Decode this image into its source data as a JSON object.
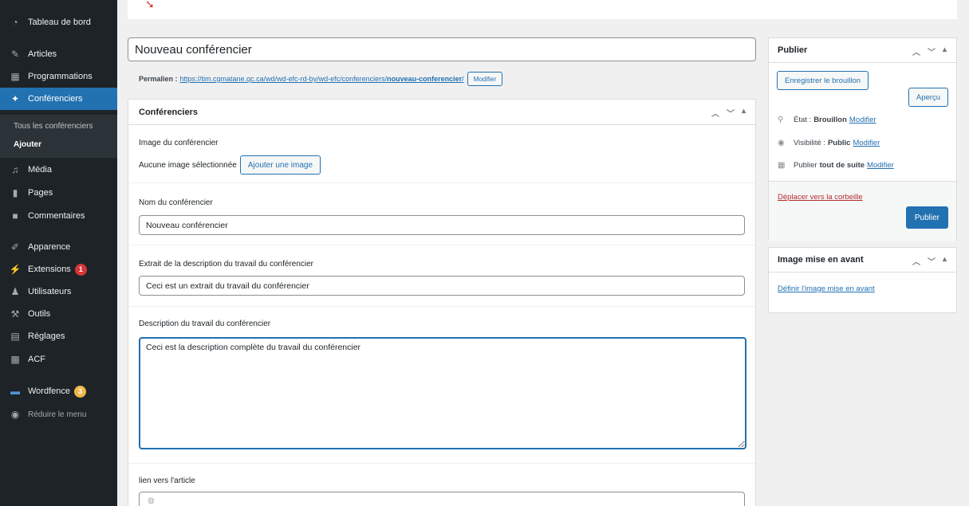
{
  "sidebar": {
    "items": [
      {
        "label": "Tableau de bord",
        "icon": "dashboard-icon"
      },
      {
        "label": "Articles",
        "icon": "pin-icon"
      },
      {
        "label": "Programmations",
        "icon": "calendar-icon"
      },
      {
        "label": "Conférenciers",
        "icon": "person-icon"
      },
      {
        "label": "Média",
        "icon": "media-icon"
      },
      {
        "label": "Pages",
        "icon": "page-icon"
      },
      {
        "label": "Commentaires",
        "icon": "comment-icon"
      },
      {
        "label": "Apparence",
        "icon": "brush-icon"
      },
      {
        "label": "Extensions",
        "icon": "plugin-icon",
        "badge": "1"
      },
      {
        "label": "Utilisateurs",
        "icon": "users-icon"
      },
      {
        "label": "Outils",
        "icon": "wrench-icon"
      },
      {
        "label": "Réglages",
        "icon": "settings-icon"
      },
      {
        "label": "ACF",
        "icon": "acf-icon"
      },
      {
        "label": "Wordfence",
        "icon": "shield-icon",
        "badge": "3"
      },
      {
        "label": "Réduire le menu",
        "icon": "collapse-icon"
      }
    ],
    "submenu": [
      {
        "label": "Tous les conférenciers"
      },
      {
        "label": "Ajouter"
      }
    ],
    "accent_color": "#2271b1"
  },
  "editor": {
    "title_value": "Nouveau conférencier",
    "permalink": {
      "label": "Permalien :",
      "url_base": "https://tim.cgmatane.qc.ca/wd/wd-efc-rd-by/wd-efc/conferenciers/",
      "url_slug": "nouveau-conferencier",
      "url_end": "/",
      "edit_label": "Modifier"
    }
  },
  "metabox": {
    "title": "Conférenciers",
    "image": {
      "label": "Image du conférencier",
      "none_text": "Aucune image sélectionnée",
      "add_button": "Ajouter une image"
    },
    "name": {
      "label": "Nom du conférencier",
      "value": "Nouveau conférencier"
    },
    "excerpt": {
      "label": "Extrait de la description du travail du conférencier",
      "value": "Ceci est un extrait du travail du conférencier"
    },
    "description": {
      "label": "Description du travail du conférencier",
      "value": "Ceci est la description complète du travail du conférencier"
    },
    "link": {
      "label": "lien vers l'article"
    }
  },
  "publish": {
    "title": "Publier",
    "save_draft": "Enregistrer le brouillon",
    "preview": "Aperçu",
    "status_label": "État :",
    "status_value": "Brouillon",
    "visibility_label": "Visibilité :",
    "visibility_value": "Public",
    "schedule_label": "Publier",
    "schedule_value": "tout de suite",
    "edit_link": "Modifier",
    "trash": "Déplacer vers la corbeille",
    "publish_button": "Publier"
  },
  "featured": {
    "title": "Image mise en avant",
    "set_link": "Définir l'image mise en avant"
  }
}
